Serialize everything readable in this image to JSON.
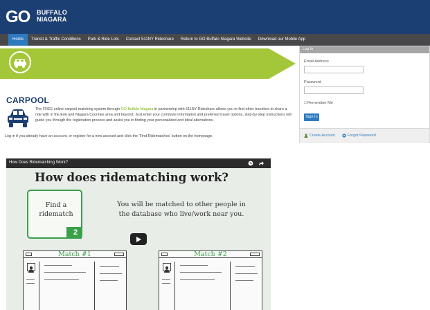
{
  "header": {
    "logo_go": "GO",
    "logo_line1": "BUFFALO",
    "logo_line2": "NIAGARA"
  },
  "nav": {
    "items": [
      {
        "label": "Home",
        "active": true
      },
      {
        "label": "Transit & Traffic Conditions"
      },
      {
        "label": "Park & Ride Lots"
      },
      {
        "label": "Contact 511NY Rideshare"
      },
      {
        "label": "Return to GO Buffalo Niagara Website"
      },
      {
        "label": "Download our Mobile App"
      }
    ]
  },
  "carpool": {
    "title": "CARPOOL",
    "desc_pre": "The FREE online carpool matching system through ",
    "desc_link": "GO Buffalo Niagara",
    "desc_post": " in partnership with 511NY Rideshare allows you to find other travelers to share a ride with in the Erie and Niagara Counties area and beyond. Just enter your commute information and preferred travel options, step-by-step instructions will guide you through the registration process and assist you in finding your personalized and ideal alternatives.",
    "login_note": "Log in if you already have an account, or register for a new account and click the 'Find Ridematches' button on the homepage."
  },
  "video": {
    "title": "How Does Ridematching Work?",
    "heading": "How does ridematching work?",
    "find_line1": "Find a",
    "find_line2": "ridematch",
    "step_number": "2",
    "matched_line1": "You will be matched to other people in",
    "matched_line2": "the database who live/work near you.",
    "match1": "Match #1",
    "match2": "Match #2"
  },
  "login": {
    "header": "Log In",
    "email_label": "Email Address",
    "email_value": "",
    "password_label": "Password",
    "password_value": "",
    "remember_label": "Remember Me",
    "signin_label": "Sign In",
    "create_account": "Create Account",
    "forgot_password": "Forgot Password"
  },
  "colors": {
    "header_bg": "#1c3f73",
    "nav_bg": "#48484a",
    "nav_active": "#2e7abf",
    "banner_green": "#a4c639",
    "video_green": "#3aa04a",
    "link_blue": "#2e7abf"
  },
  "icons": {
    "banner": "car-icon",
    "carpool": "car-icon",
    "create_account": "user-icon",
    "forgot_password": "key-icon",
    "video_clock": "clock-icon",
    "video_share": "share-icon",
    "video_play": "play-icon"
  }
}
